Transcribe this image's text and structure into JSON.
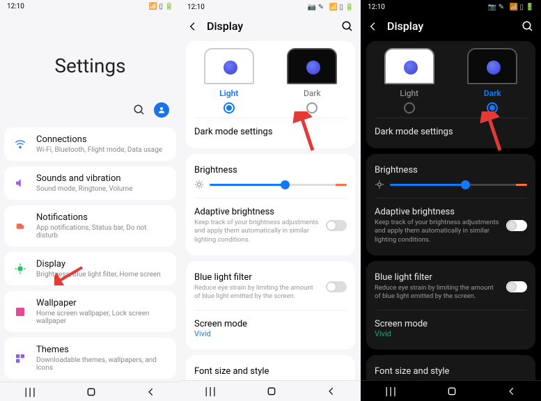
{
  "status": {
    "time": "12:10",
    "signal": "📶",
    "wifi": "📡",
    "battery": "🔋",
    "edit": "✎",
    "camera": "📷"
  },
  "nav": {
    "recent": "|||",
    "home": "◯",
    "back": "<"
  },
  "colors": {
    "accent": "#1279ff",
    "darkAccentGreen": "#23a27a",
    "arrowRed": "#e53935"
  },
  "p1": {
    "heroTitle": "Settings",
    "items": [
      {
        "key": "connections",
        "title": "Connections",
        "sub": "Wi-Fi, Bluetooth, Flight mode, Data usage",
        "iconColor": "#3b82f6",
        "glyph": "wifi"
      },
      {
        "key": "sounds",
        "title": "Sounds and vibration",
        "sub": "Sound mode, Ringtone, Volume",
        "iconColor": "#a855f7",
        "glyph": "sound"
      },
      {
        "key": "notifications",
        "title": "Notifications",
        "sub": "App notifications, Status bar, Do not disturb",
        "iconColor": "#ec6b4c",
        "glyph": "notif"
      },
      {
        "key": "display",
        "title": "Display",
        "sub": "Brightness, Blue light filter, Home screen",
        "iconColor": "#22c55e",
        "glyph": "display"
      },
      {
        "key": "wallpaper",
        "title": "Wallpaper",
        "sub": "Home screen wallpaper, Lock screen wallpaper",
        "iconColor": "#ec4899",
        "glyph": "wallpaper"
      },
      {
        "key": "themes",
        "title": "Themes",
        "sub": "Downloadable themes, wallpapers, and icons",
        "iconColor": "#8b5cf6",
        "glyph": "themes"
      }
    ]
  },
  "display": {
    "appTitle": "Display",
    "lightLabel": "Light",
    "darkLabel": "Dark",
    "darkModeSettings": "Dark mode settings",
    "brightness": {
      "label": "Brightness",
      "value": 55
    },
    "adaptive": {
      "title": "Adaptive brightness",
      "sub": "Keep track of your brightness adjustments and apply them automatically in similar lighting conditions.",
      "on": false
    },
    "blueLight": {
      "title": "Blue light filter",
      "sub": "Reduce eye strain by limiting the amount of blue light emitted by the screen.",
      "on": false
    },
    "screenMode": {
      "title": "Screen mode",
      "value": "Vivid"
    },
    "fontSize": "Font size and style"
  }
}
